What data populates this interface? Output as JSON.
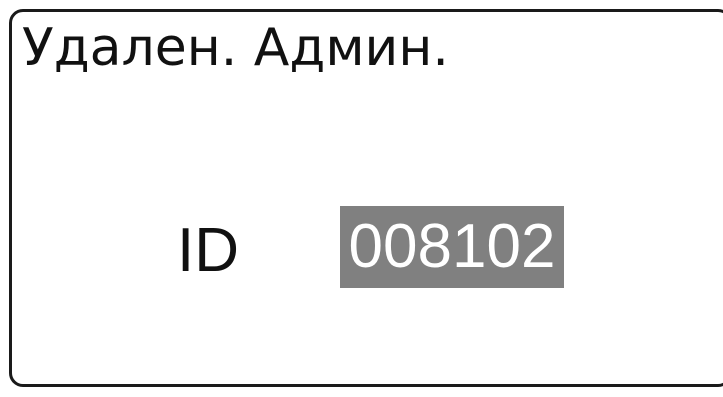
{
  "screen": {
    "title": "Удален. Админ."
  },
  "id_field": {
    "label": "ID",
    "value": "008102",
    "highlight_color": "#808080"
  }
}
